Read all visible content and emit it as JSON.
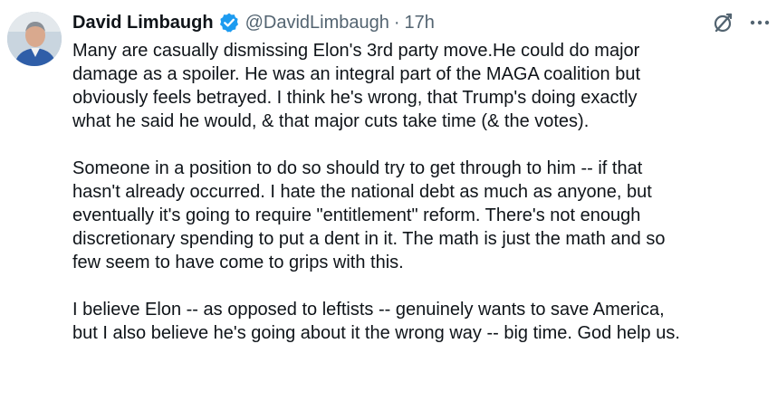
{
  "tweet": {
    "author": {
      "display_name": "David Limbaugh",
      "handle": "@DavidLimbaugh",
      "verified": true
    },
    "separator": "·",
    "timestamp": "17h",
    "icons": {
      "verified": "verified-badge-icon",
      "grok": "grok-icon",
      "more": "more-options-icon",
      "avatar": "avatar"
    },
    "colors": {
      "verified_blue": "#1d9bf0",
      "secondary_text": "#536471",
      "primary_text": "#0f1419"
    },
    "paragraphs": [
      {
        "lines": [
          "Many are casually dismissing Elon's 3rd party move.He could do major",
          "damage as a spoiler. He was an integral part of the MAGA coalition but",
          "obviously feels betrayed. I think he's wrong, that Trump's doing exactly",
          "what he said he would, & that major cuts take time (& the votes)."
        ]
      },
      {
        "lines": [
          "Someone in a position to do so should try to get through to him -- if that",
          "hasn't already occurred. I hate the national debt as much as anyone, but",
          "eventually it's going to require \"entitlement\" reform. There's not enough",
          "discretionary spending to put a dent in it. The math is just the math and so",
          "few seem to have come to grips with this."
        ]
      },
      {
        "lines": [
          "I believe Elon -- as opposed to leftists -- genuinely wants to save America,",
          "but I also believe he's going about it the wrong way -- big time. God help us."
        ]
      }
    ]
  }
}
